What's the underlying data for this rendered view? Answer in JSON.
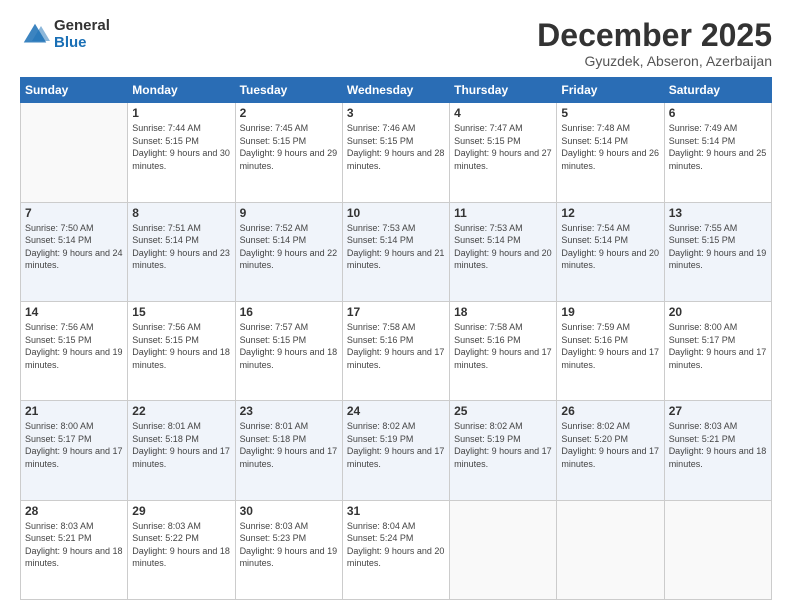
{
  "logo": {
    "general": "General",
    "blue": "Blue"
  },
  "header": {
    "month": "December 2025",
    "location": "Gyuzdek, Abseron, Azerbaijan"
  },
  "days_of_week": [
    "Sunday",
    "Monday",
    "Tuesday",
    "Wednesday",
    "Thursday",
    "Friday",
    "Saturday"
  ],
  "weeks": [
    [
      {
        "day": null
      },
      {
        "day": 1,
        "sunrise": "7:44 AM",
        "sunset": "5:15 PM",
        "daylight": "9 hours and 30 minutes."
      },
      {
        "day": 2,
        "sunrise": "7:45 AM",
        "sunset": "5:15 PM",
        "daylight": "9 hours and 29 minutes."
      },
      {
        "day": 3,
        "sunrise": "7:46 AM",
        "sunset": "5:15 PM",
        "daylight": "9 hours and 28 minutes."
      },
      {
        "day": 4,
        "sunrise": "7:47 AM",
        "sunset": "5:15 PM",
        "daylight": "9 hours and 27 minutes."
      },
      {
        "day": 5,
        "sunrise": "7:48 AM",
        "sunset": "5:14 PM",
        "daylight": "9 hours and 26 minutes."
      },
      {
        "day": 6,
        "sunrise": "7:49 AM",
        "sunset": "5:14 PM",
        "daylight": "9 hours and 25 minutes."
      }
    ],
    [
      {
        "day": 7,
        "sunrise": "7:50 AM",
        "sunset": "5:14 PM",
        "daylight": "9 hours and 24 minutes."
      },
      {
        "day": 8,
        "sunrise": "7:51 AM",
        "sunset": "5:14 PM",
        "daylight": "9 hours and 23 minutes."
      },
      {
        "day": 9,
        "sunrise": "7:52 AM",
        "sunset": "5:14 PM",
        "daylight": "9 hours and 22 minutes."
      },
      {
        "day": 10,
        "sunrise": "7:53 AM",
        "sunset": "5:14 PM",
        "daylight": "9 hours and 21 minutes."
      },
      {
        "day": 11,
        "sunrise": "7:53 AM",
        "sunset": "5:14 PM",
        "daylight": "9 hours and 20 minutes."
      },
      {
        "day": 12,
        "sunrise": "7:54 AM",
        "sunset": "5:14 PM",
        "daylight": "9 hours and 20 minutes."
      },
      {
        "day": 13,
        "sunrise": "7:55 AM",
        "sunset": "5:15 PM",
        "daylight": "9 hours and 19 minutes."
      }
    ],
    [
      {
        "day": 14,
        "sunrise": "7:56 AM",
        "sunset": "5:15 PM",
        "daylight": "9 hours and 19 minutes."
      },
      {
        "day": 15,
        "sunrise": "7:56 AM",
        "sunset": "5:15 PM",
        "daylight": "9 hours and 18 minutes."
      },
      {
        "day": 16,
        "sunrise": "7:57 AM",
        "sunset": "5:15 PM",
        "daylight": "9 hours and 18 minutes."
      },
      {
        "day": 17,
        "sunrise": "7:58 AM",
        "sunset": "5:16 PM",
        "daylight": "9 hours and 17 minutes."
      },
      {
        "day": 18,
        "sunrise": "7:58 AM",
        "sunset": "5:16 PM",
        "daylight": "9 hours and 17 minutes."
      },
      {
        "day": 19,
        "sunrise": "7:59 AM",
        "sunset": "5:16 PM",
        "daylight": "9 hours and 17 minutes."
      },
      {
        "day": 20,
        "sunrise": "8:00 AM",
        "sunset": "5:17 PM",
        "daylight": "9 hours and 17 minutes."
      }
    ],
    [
      {
        "day": 21,
        "sunrise": "8:00 AM",
        "sunset": "5:17 PM",
        "daylight": "9 hours and 17 minutes."
      },
      {
        "day": 22,
        "sunrise": "8:01 AM",
        "sunset": "5:18 PM",
        "daylight": "9 hours and 17 minutes."
      },
      {
        "day": 23,
        "sunrise": "8:01 AM",
        "sunset": "5:18 PM",
        "daylight": "9 hours and 17 minutes."
      },
      {
        "day": 24,
        "sunrise": "8:02 AM",
        "sunset": "5:19 PM",
        "daylight": "9 hours and 17 minutes."
      },
      {
        "day": 25,
        "sunrise": "8:02 AM",
        "sunset": "5:19 PM",
        "daylight": "9 hours and 17 minutes."
      },
      {
        "day": 26,
        "sunrise": "8:02 AM",
        "sunset": "5:20 PM",
        "daylight": "9 hours and 17 minutes."
      },
      {
        "day": 27,
        "sunrise": "8:03 AM",
        "sunset": "5:21 PM",
        "daylight": "9 hours and 18 minutes."
      }
    ],
    [
      {
        "day": 28,
        "sunrise": "8:03 AM",
        "sunset": "5:21 PM",
        "daylight": "9 hours and 18 minutes."
      },
      {
        "day": 29,
        "sunrise": "8:03 AM",
        "sunset": "5:22 PM",
        "daylight": "9 hours and 18 minutes."
      },
      {
        "day": 30,
        "sunrise": "8:03 AM",
        "sunset": "5:23 PM",
        "daylight": "9 hours and 19 minutes."
      },
      {
        "day": 31,
        "sunrise": "8:04 AM",
        "sunset": "5:24 PM",
        "daylight": "9 hours and 20 minutes."
      },
      {
        "day": null
      },
      {
        "day": null
      },
      {
        "day": null
      }
    ]
  ]
}
